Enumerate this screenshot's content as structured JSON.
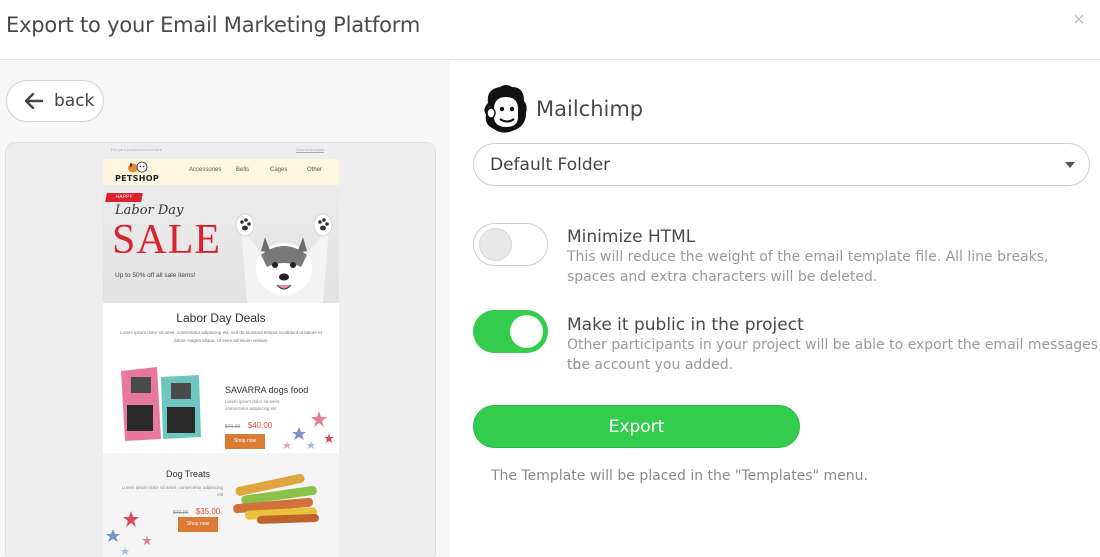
{
  "dialog": {
    "title": "Export to your Email Marketing Platform",
    "close_icon": "close-icon",
    "close_glyph": "×"
  },
  "back": {
    "label": "back",
    "icon": "arrow-left-icon"
  },
  "preview": {
    "top_left": "Put your preheader text here",
    "top_right": "View in browser",
    "logo_text": "PETSHOP",
    "menu": [
      "Accessories",
      "Bells",
      "Cages",
      "Other"
    ],
    "hero": {
      "badge": "HAPPY",
      "script": "Labor Day",
      "sale": "SALE",
      "subtitle": "Up to 50% off all sale items!"
    },
    "deals": {
      "title": "Labor Day Deals",
      "text": "Lorem ipsum dolor sit amet, consectetur adipiscing elit, sed do eiusmod tempor incididunt ut labore et dolore magna aliqua. Ut enim ad minim veniam."
    },
    "product1": {
      "title": "SAVARRA dogs food",
      "desc": "Lorem ipsum dolor sit amet, consectetur adipiscing elit",
      "old_price": "$70.00",
      "new_price": "$40.00",
      "button": "Shop now"
    },
    "product2": {
      "title": "Dog Treats",
      "desc": "Lorem ipsum dolor sit amet, consectetur adipiscing elit",
      "old_price": "$70.00",
      "new_price": "$35.00",
      "button": "Shop now"
    }
  },
  "provider": {
    "name": "Mailchimp",
    "icon": "mailchimp-logo-icon"
  },
  "folder": {
    "selected": "Default Folder"
  },
  "options": [
    {
      "title": "Minimize HTML",
      "desc_line1": "This will reduce the weight of the email template file. All line breaks,",
      "desc_line2": "spaces and extra characters will be deleted.",
      "enabled": false
    },
    {
      "title": "Make it public in the project",
      "desc_line1": "Other participants in your project will be able to export the email messages to",
      "desc_line2": "the account you added.",
      "enabled": true
    }
  ],
  "export": {
    "label": "Export",
    "note": "The Template will be placed in the \"Templates\" menu."
  },
  "colors": {
    "accent_green": "#33cc4c",
    "sale_red": "#d9242f",
    "shop_orange": "#dc7b34"
  }
}
